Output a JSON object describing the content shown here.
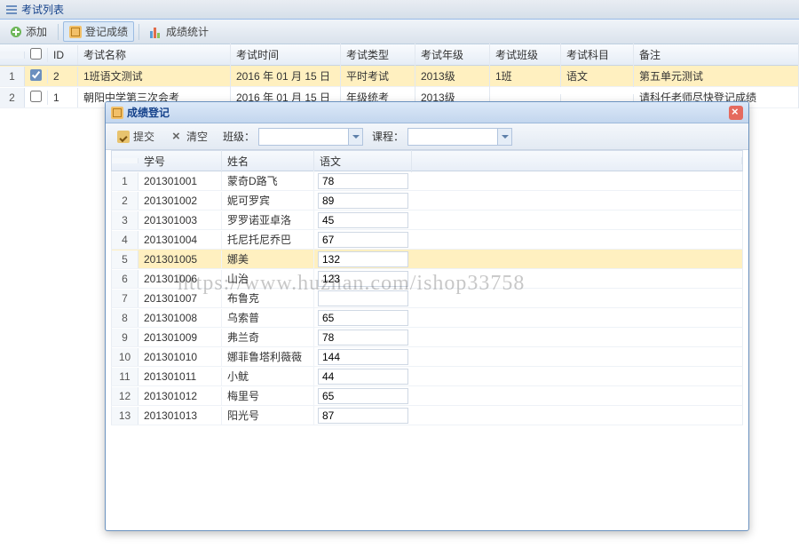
{
  "panel": {
    "title": "考试列表"
  },
  "toolbar": {
    "add_label": "添加",
    "register_label": "登记成绩",
    "stats_label": "成绩统计"
  },
  "grid": {
    "headers": {
      "id": "ID",
      "name": "考试名称",
      "time": "考试时间",
      "type": "考试类型",
      "grade": "考试年级",
      "class": "考试班级",
      "subject": "考试科目",
      "note": "备注"
    },
    "rows": [
      {
        "num": "1",
        "checked": true,
        "id": "2",
        "name": "1班语文测试",
        "time": "2016 年 01 月 15 日",
        "type": "平时考试",
        "grade": "2013级",
        "class": "1班",
        "subject": "语文",
        "note": "第五单元测试",
        "selected": true
      },
      {
        "num": "2",
        "checked": false,
        "id": "1",
        "name": "朝阳中学第三次会考",
        "time": "2016 年 01 月 15 日",
        "type": "年级统考",
        "grade": "2013级",
        "class": "",
        "subject": "",
        "note": "请科任老师尽快登记成绩",
        "selected": false
      }
    ]
  },
  "dialog": {
    "title": "成绩登记",
    "submit_label": "提交",
    "clear_label": "清空",
    "class_label": "班级：",
    "course_label": "课程：",
    "class_value": "",
    "course_value": "",
    "headers": {
      "sid": "学号",
      "name": "姓名",
      "score_col": "语文"
    },
    "rows": [
      {
        "num": "1",
        "sid": "201301001",
        "name": "蒙奇D路飞",
        "score": "78"
      },
      {
        "num": "2",
        "sid": "201301002",
        "name": "妮可罗宾",
        "score": "89"
      },
      {
        "num": "3",
        "sid": "201301003",
        "name": "罗罗诺亚卓洛",
        "score": "45"
      },
      {
        "num": "4",
        "sid": "201301004",
        "name": "托尼托尼乔巴",
        "score": "67"
      },
      {
        "num": "5",
        "sid": "201301005",
        "name": "娜美",
        "score": "132",
        "selected": true
      },
      {
        "num": "6",
        "sid": "201301006",
        "name": "山治",
        "score": "123"
      },
      {
        "num": "7",
        "sid": "201301007",
        "name": "布鲁克",
        "score": ""
      },
      {
        "num": "8",
        "sid": "201301008",
        "name": "乌索普",
        "score": "65"
      },
      {
        "num": "9",
        "sid": "201301009",
        "name": "弗兰奇",
        "score": "78"
      },
      {
        "num": "10",
        "sid": "201301010",
        "name": "娜菲鲁塔利薇薇",
        "score": "144"
      },
      {
        "num": "11",
        "sid": "201301011",
        "name": "小鱿",
        "score": "44"
      },
      {
        "num": "12",
        "sid": "201301012",
        "name": "梅里号",
        "score": "65"
      },
      {
        "num": "13",
        "sid": "201301013",
        "name": "阳光号",
        "score": "87"
      }
    ]
  },
  "watermark": "https://www.huzhan.com/ishop33758"
}
